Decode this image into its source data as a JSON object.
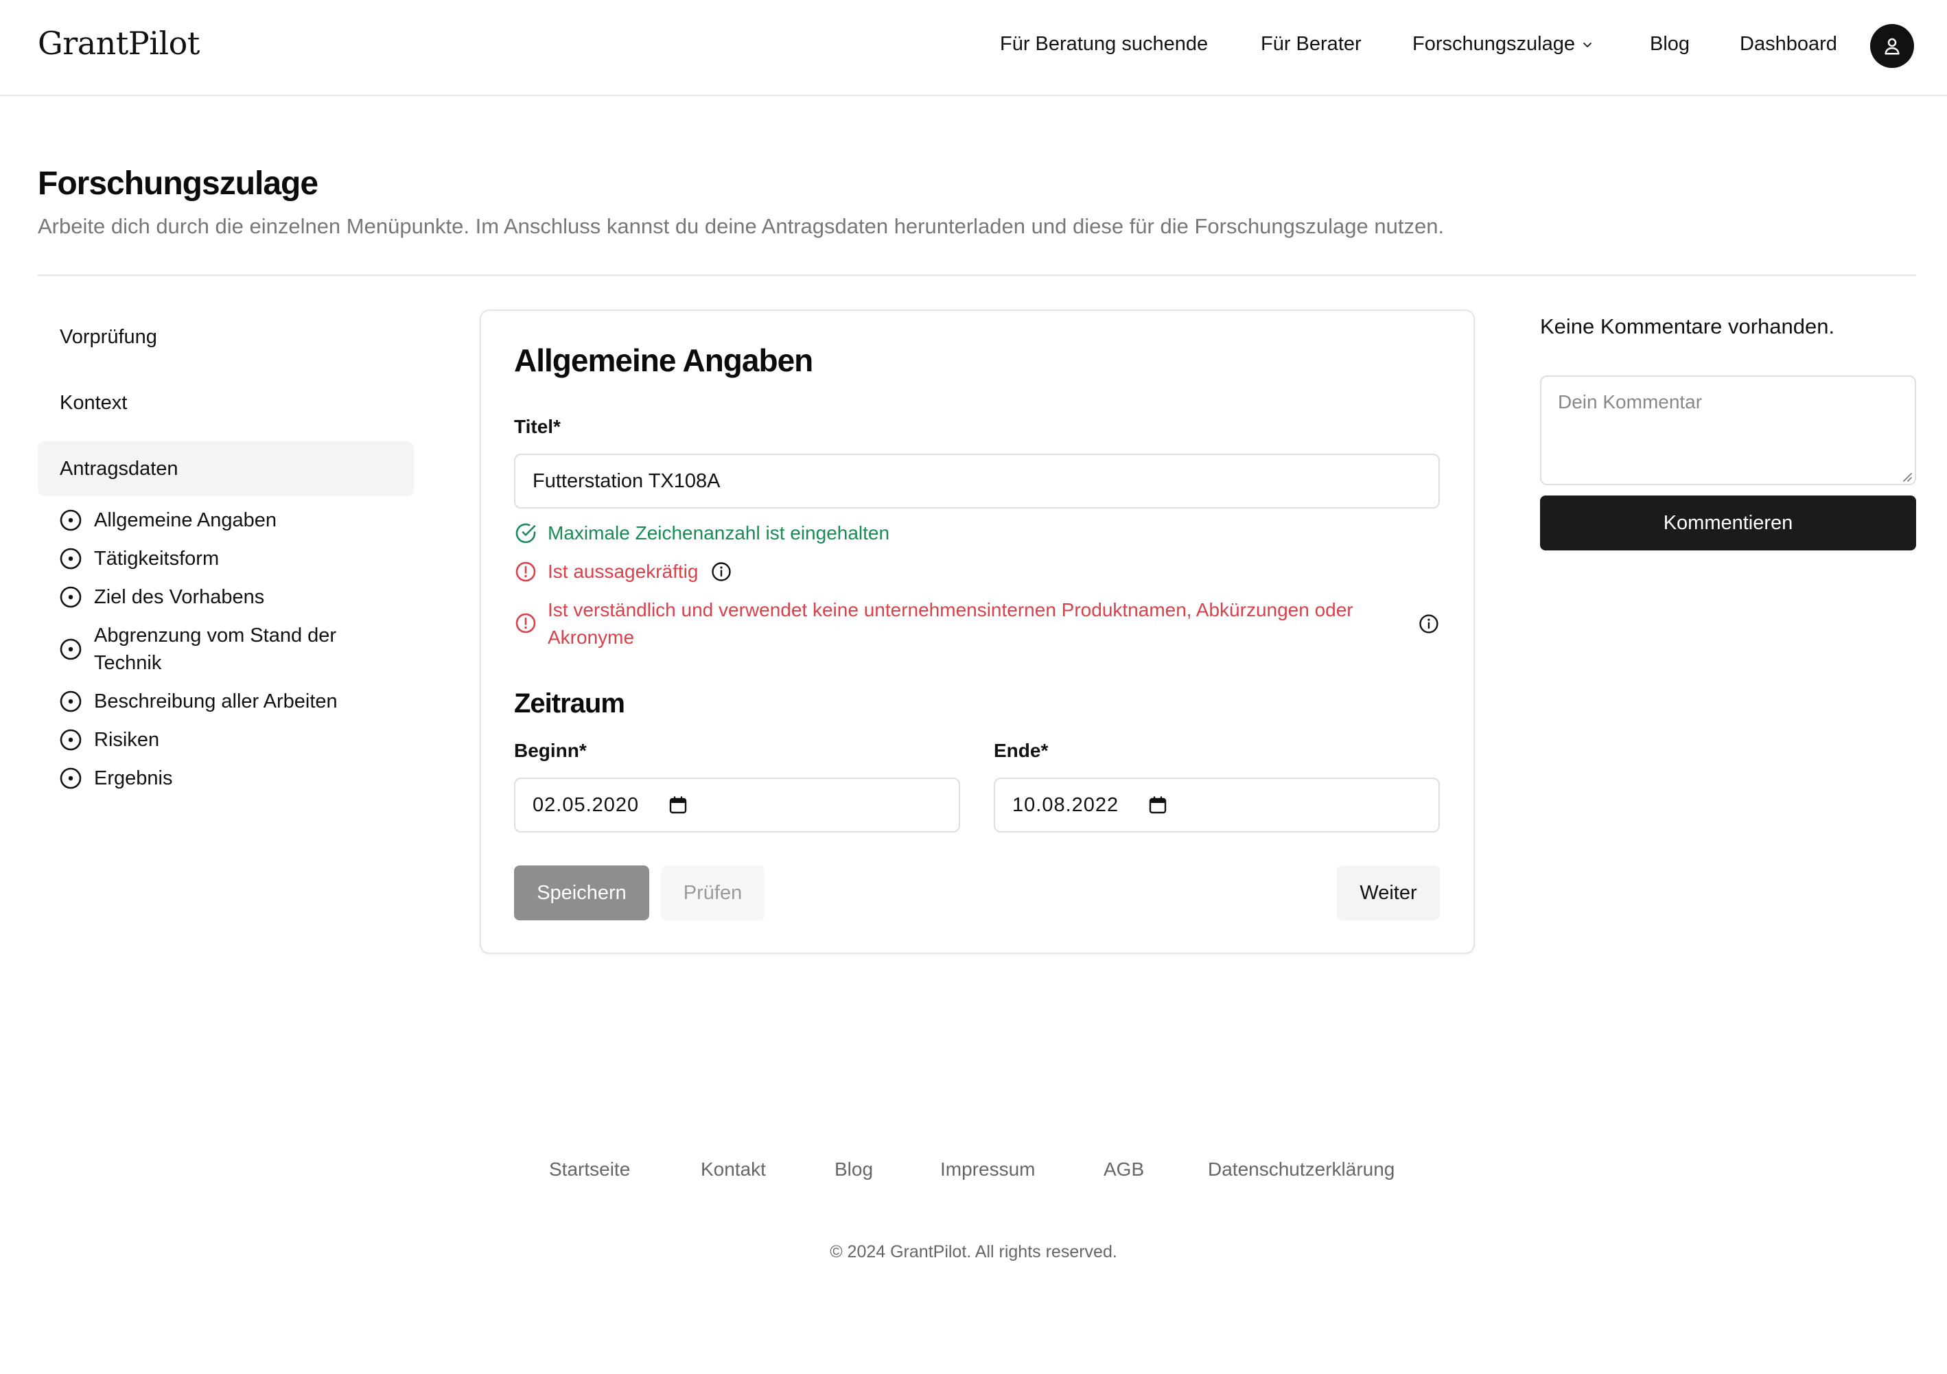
{
  "header": {
    "logo": "GrantPilot",
    "nav": [
      "Für Beratung suchende",
      "Für Berater",
      "Forschungszulage",
      "Blog",
      "Dashboard"
    ]
  },
  "page": {
    "title": "Forschungszulage",
    "subtitle": "Arbeite dich durch die einzelnen Menüpunkte. Im Anschluss kannst du deine Antragsdaten herunterladen und diese für die Forschungszulage nutzen."
  },
  "sidebar": {
    "sections": [
      "Vorprüfung",
      "Kontext",
      "Antragsdaten"
    ],
    "active_section": "Antragsdaten",
    "subitems": [
      "Allgemeine Angaben",
      "Tätigkeitsform",
      "Ziel des Vorhabens",
      "Abgrenzung vom Stand der Technik",
      "Beschreibung aller Arbeiten",
      "Risiken",
      "Ergebnis"
    ]
  },
  "form": {
    "title": "Allgemeine Angaben",
    "title_label": "Titel*",
    "title_value": "Futterstation TX108A",
    "checks": [
      {
        "text": "Maximale Zeichenanzahl ist eingehalten",
        "status": "ok"
      },
      {
        "text": "Ist aussagekräftig",
        "status": "error"
      },
      {
        "text": "Ist verständlich und verwendet keine unternehmensinternen Produktnamen, Abkürzungen oder Akronyme",
        "status": "error"
      }
    ],
    "period_title": "Zeitraum",
    "start_label": "Beginn*",
    "start_value": "02.05.2020",
    "end_label": "Ende*",
    "end_value": "10.08.2022",
    "buttons": {
      "save": "Speichern",
      "check": "Prüfen",
      "next": "Weiter"
    }
  },
  "comments": {
    "empty_text": "Keine Kommentare vorhanden.",
    "placeholder": "Dein Kommentar",
    "submit": "Kommentieren"
  },
  "footer": {
    "links": [
      "Startseite",
      "Kontakt",
      "Blog",
      "Impressum",
      "AGB",
      "Datenschutzerklärung"
    ],
    "copyright": "© 2024 GrantPilot. All rights reserved."
  },
  "colors": {
    "success": "#1a8a55",
    "error": "#d9404a",
    "primary_dark": "#1b1b1b"
  }
}
